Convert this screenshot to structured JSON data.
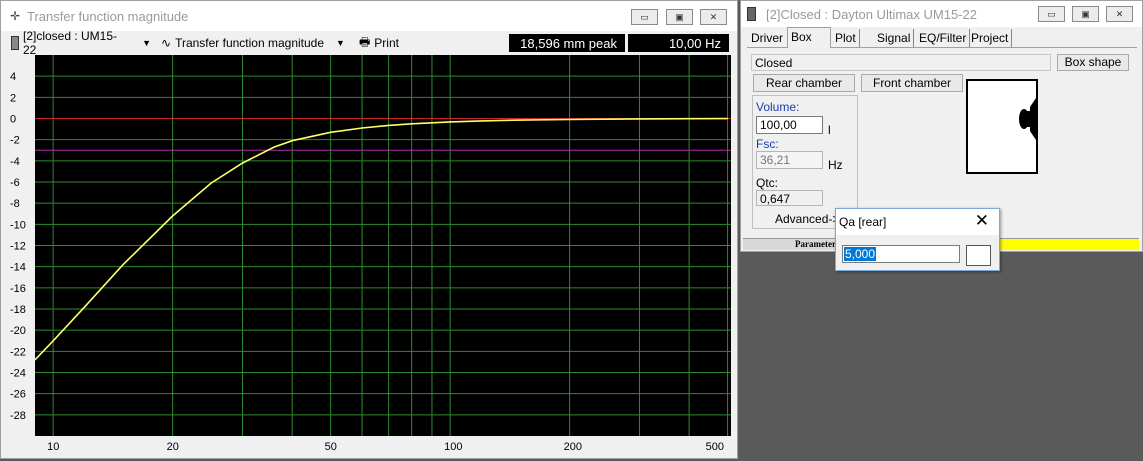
{
  "left_window": {
    "title": "Transfer function magnitude",
    "icon": "crosshair-icon",
    "driver_combo": "[2]closed : UM15-22",
    "mode_combo": "Transfer function magnitude",
    "print_label": "Print",
    "readout_peak": "18,596 mm peak",
    "readout_freq": "10,00 Hz"
  },
  "right_window": {
    "title": "[2]Closed : Dayton Ultimax UM15-22",
    "tabs": [
      "Driver",
      "Box",
      "Plot",
      "Signal",
      "EQ/Filter",
      "Project"
    ],
    "active_tab": "Box",
    "box_type": "Closed",
    "box_shape_button": "Box shape",
    "rear_chamber_button": "Rear chamber",
    "front_chamber_button": "Front chamber",
    "volume_label": "Volume:",
    "volume_value": "100,00",
    "volume_unit": "l",
    "fsc_label": "Fsc:",
    "fsc_value": "36,21",
    "fsc_unit": "Hz",
    "qtc_label": "Qtc:",
    "qtc_value": "0,647",
    "advanced_label": "Advanced->",
    "status_label": "Parameter"
  },
  "popup": {
    "title": "Qa [rear]",
    "value": "5,000"
  },
  "colors": {
    "plot_bg": "#000000",
    "grid": "#2e8b2e",
    "curve": "#ffff66",
    "zero_line": "#cc2222",
    "ref_line": "#aa33aa",
    "status_bar": "#ffff00"
  },
  "chart_data": {
    "type": "line",
    "xscale": "log",
    "xlim": [
      9,
      510
    ],
    "ylim": [
      -30,
      6
    ],
    "x_tick_labels": [
      "10",
      "20",
      "50",
      "100",
      "200",
      "500"
    ],
    "x_ticks": [
      10,
      20,
      50,
      100,
      200,
      500
    ],
    "y_ticks": [
      4,
      2,
      0,
      -2,
      -4,
      -6,
      -8,
      -10,
      -12,
      -14,
      -16,
      -18,
      -20,
      -22,
      -24,
      -26,
      -28
    ],
    "y_tick_labels": [
      "4",
      "2",
      "0",
      "-2",
      "-4",
      "-6",
      "-8",
      "-10",
      "-12",
      "-14",
      "-16",
      "-18",
      "-20",
      "-22",
      "-24",
      "-26",
      "-28"
    ],
    "reference_lines": [
      0,
      -3
    ],
    "series": [
      {
        "x": [
          9,
          10,
          12,
          15,
          20,
          25,
          30,
          36,
          40,
          50,
          60,
          70,
          80,
          100,
          120,
          150,
          200,
          300,
          400,
          500
        ],
        "y": [
          -22.8,
          -21.0,
          -17.8,
          -13.8,
          -9.2,
          -6.1,
          -4.2,
          -2.7,
          -2.1,
          -1.3,
          -0.9,
          -0.65,
          -0.5,
          -0.32,
          -0.23,
          -0.15,
          -0.09,
          -0.04,
          -0.02,
          -0.01
        ]
      }
    ]
  }
}
